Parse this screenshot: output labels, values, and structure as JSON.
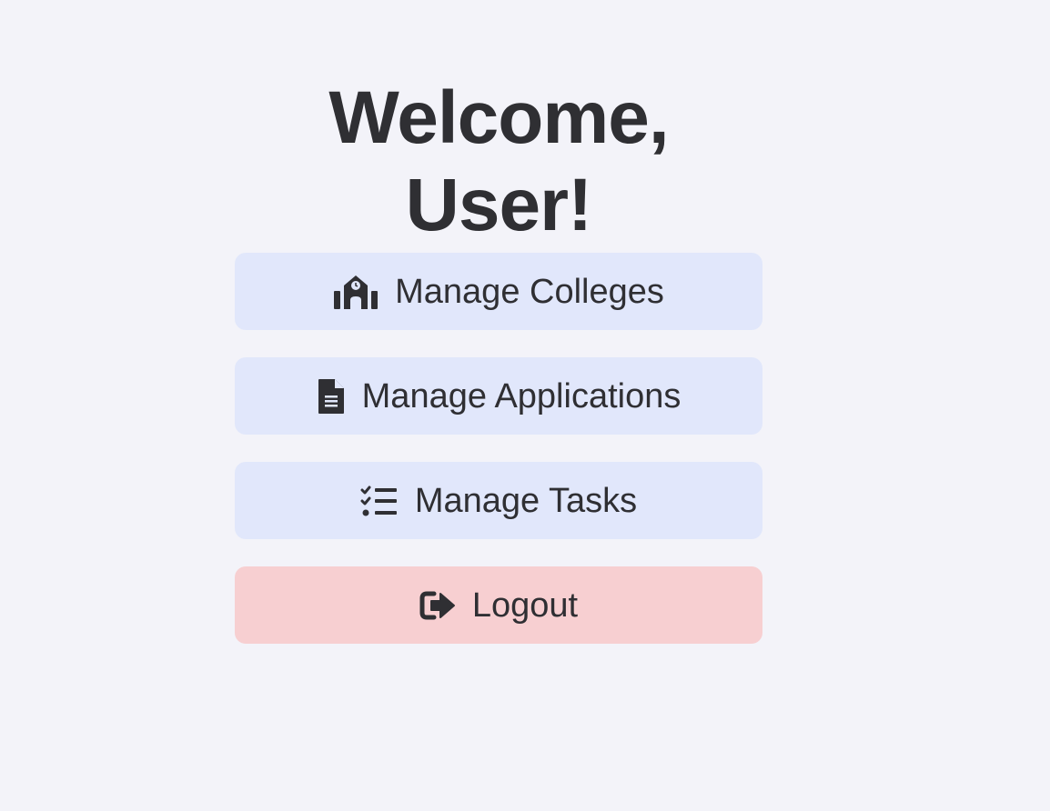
{
  "header": {
    "title": "Welcome, User!"
  },
  "menu": {
    "items": [
      {
        "label": "Manage Colleges",
        "icon": "school-icon"
      },
      {
        "label": "Manage Applications",
        "icon": "file-icon"
      },
      {
        "label": "Manage Tasks",
        "icon": "tasks-list-icon"
      },
      {
        "label": "Logout",
        "icon": "logout-icon"
      }
    ]
  },
  "colors": {
    "background": "#f3f3f9",
    "button": "#e1e7fb",
    "logout_button": "#f7cfd1",
    "text": "#2f2f33"
  }
}
